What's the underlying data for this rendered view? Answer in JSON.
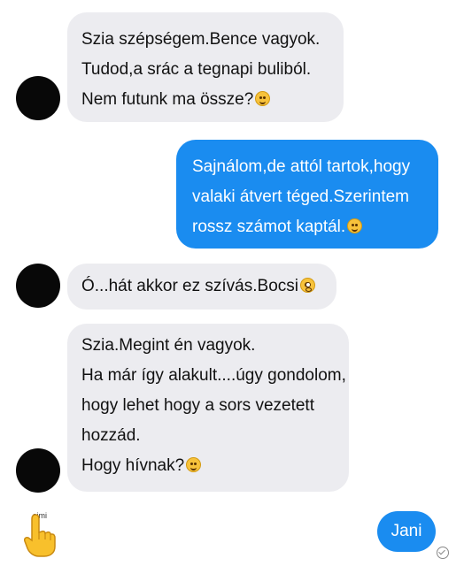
{
  "messages": [
    {
      "from": "other",
      "lines": [
        "Szia szépségem.Bence vagyok.",
        "Tudod,a srác a tegnapi buliból.",
        "Nem futunk ma össze?"
      ],
      "emoji": "wink-face-icon"
    },
    {
      "from": "me",
      "lines": [
        "Sajnálom,de attól tartok,hogy",
        "valaki átvert téged.Szerintem",
        "rossz számot kaptál."
      ],
      "emoji": "smiling-face-icon"
    },
    {
      "from": "other",
      "lines": [
        "Ó...hát akkor ez szívás.Bocsi"
      ],
      "emoji": "flushed-face-icon"
    },
    {
      "from": "other",
      "lines": [
        "Szia.Megint én vagyok.",
        "Ha már így alakult....úgy gondolom,",
        "hogy lehet hogy a sors vezetett",
        "hozzád.",
        "Hogy hívnak?"
      ],
      "emoji": "smiling-face-icon"
    },
    {
      "from": "me",
      "lines": [
        "Jani"
      ]
    }
  ],
  "overlay": {
    "simi_label": "simi",
    "hand_icon": "pointing-hand-icon"
  },
  "status_icon": "seen-check-icon",
  "colors": {
    "outgoing_bubble": "#1a8cf0",
    "incoming_bubble": "#ececf0",
    "avatar": "#080808",
    "background": "#ffffff"
  }
}
